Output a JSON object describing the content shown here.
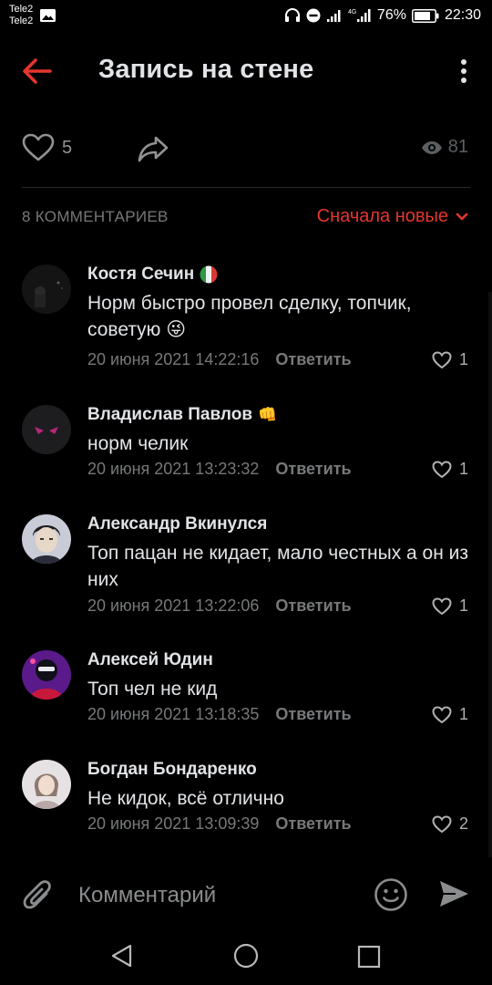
{
  "status_bar": {
    "carrier_1": "Tele2",
    "carrier_2": "Tele2",
    "network": "4G",
    "battery": "76%",
    "time": "22:30"
  },
  "header": {
    "title": "Запись на стене",
    "back_icon": "arrow-left-icon",
    "menu_icon": "more-vertical-icon",
    "accent_color": "#e6352d"
  },
  "post_actions": {
    "likes": "5",
    "views": "81"
  },
  "comments_section": {
    "count_label": "8 КОММЕНТАРИЕВ",
    "sort_label": "Сначала новые",
    "reply_label": "Ответить"
  },
  "comments": [
    {
      "author": "Костя Сечин",
      "badge": "italian-flag",
      "text": "Норм быстро провел сделку, топчик, советую",
      "emoji": "😜",
      "date": "20 июня 2021 14:22:16",
      "likes": "1"
    },
    {
      "author": "Владислав Павлов",
      "badge": "👊",
      "text": "норм челик",
      "date": "20 июня 2021 13:23:32",
      "likes": "1"
    },
    {
      "author": "Александр Вкинулся",
      "text": "Топ пацан не кидает, мало честных а он из них",
      "date": "20 июня 2021 13:22:06",
      "likes": "1"
    },
    {
      "author": "Алексей Юдин",
      "text": "Топ чел не кид",
      "date": "20 июня 2021 13:18:35",
      "likes": "1"
    },
    {
      "author": "Богдан Бондаренко",
      "text": "Не кидок, всё отлично",
      "date": "20 июня 2021 13:09:39",
      "likes": "2"
    }
  ],
  "composer": {
    "placeholder": "Комментарий"
  }
}
